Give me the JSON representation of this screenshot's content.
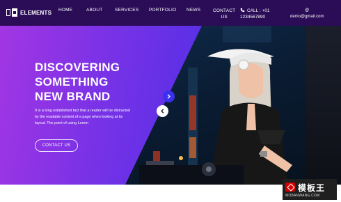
{
  "brand": {
    "name": "ELEMENTS"
  },
  "nav": {
    "items": [
      {
        "label": "HOME"
      },
      {
        "label": "ABOUT"
      },
      {
        "label": "SERVICES"
      },
      {
        "label": "PORTFOLIO"
      },
      {
        "label": "NEWS"
      },
      {
        "label_line1": "CONTACT",
        "label_line2": "US"
      }
    ],
    "call": {
      "line1": "CALL : +01",
      "line2": "1234567890"
    },
    "email": {
      "line1": "@",
      "line2": "demo@gmail.com"
    }
  },
  "hero": {
    "title_line1": "DISCOVERING",
    "title_line2": "SOMETHING",
    "title_line3": "NEW BRAND",
    "text": "It is a long established fact that a reader will be distracted by the readable content of a page when looking at its layout. The point of using Lorem",
    "button": "CONTACT US"
  },
  "watermark": {
    "cn": "模板王",
    "en": "MOBANWANG.COM"
  },
  "colors": {
    "nav_bg": "#2a0c57",
    "hero_gradient_start": "#a236e3",
    "hero_gradient_end": "#3f2ed6",
    "accent": "#3b2ff0"
  },
  "icons": {
    "phone": "phone-icon",
    "prev": "chevron-left-icon",
    "next": "chevron-right-icon",
    "logo": "logo-icon"
  }
}
